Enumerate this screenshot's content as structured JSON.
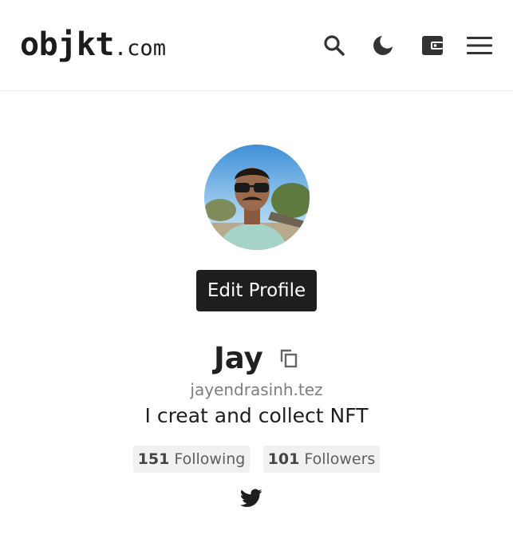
{
  "header": {
    "logo_main": "objkt",
    "logo_tld": ".com",
    "icons": [
      "search-icon",
      "moon-icon",
      "wallet-icon",
      "menu-icon"
    ]
  },
  "profile": {
    "edit_button": "Edit Profile",
    "name": "Jay",
    "handle": "jayendrasinh.tez",
    "bio": "I creat and collect NFT",
    "following_count": "151",
    "following_label": "Following",
    "followers_count": "101",
    "followers_label": "Followers",
    "social_icon": "twitter-icon"
  },
  "colors": {
    "button_bg": "#1e1e1e",
    "pill_bg": "#f1f1f1",
    "icon_color": "#333333"
  }
}
